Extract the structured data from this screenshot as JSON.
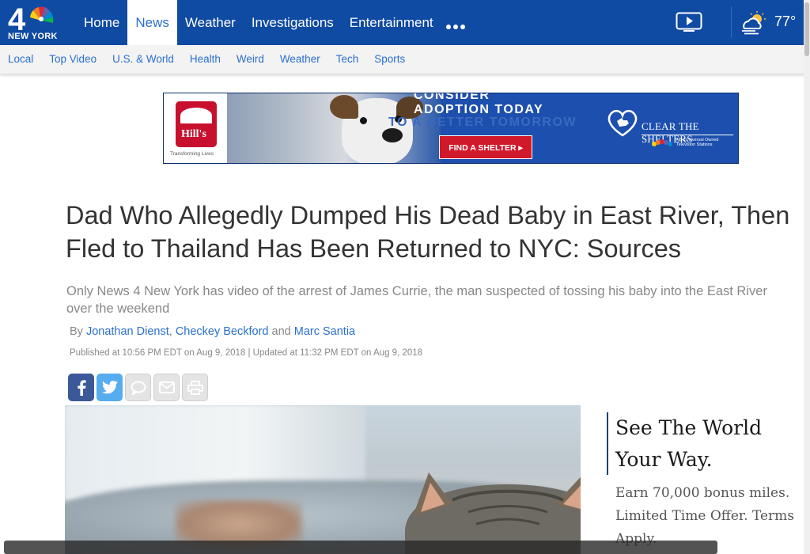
{
  "brand": {
    "logo_text": "NEW YORK"
  },
  "nav": {
    "items": [
      {
        "label": "Home",
        "active": false
      },
      {
        "label": "News",
        "active": true
      },
      {
        "label": "Weather",
        "active": false
      },
      {
        "label": "Investigations",
        "active": false
      },
      {
        "label": "Entertainment",
        "active": false
      }
    ],
    "more_icon": "more-dots-icon",
    "video_icon": "video-play-icon"
  },
  "weather": {
    "icon": "partly-cloudy-icon",
    "temp": "77°"
  },
  "subnav": {
    "items": [
      "Local",
      "Top Video",
      "U.S. & World",
      "Health",
      "Weird",
      "Weather",
      "Tech",
      "Sports"
    ]
  },
  "ad": {
    "hills_brand": "Hill's",
    "hills_tagline": "Transforming Lives",
    "headline_top": "CONSIDER",
    "headline": "ADOPTION TODAY",
    "ghost_text": "TO A BETTER TOMORROW",
    "cta": "FIND A SHELTER ▸",
    "partner": "CLEAR THE SHELTERS",
    "partner_sub": "NBCUniversal Owned Television Stations"
  },
  "article": {
    "headline": "Dad Who Allegedly Dumped His Dead Baby in East River, Then Fled to Thailand Has Been Returned to NYC: Sources",
    "headline_line1": "Dad Who Allegedly Dumped His Dead Baby in East River, Then",
    "headline_line2": "Fled to Thailand Has Been Returned to NYC: Sources",
    "dek_line1": "Only News 4 New York has video of the arrest of James Currie, the man suspected of tossing his baby into the East River",
    "dek_line2": "over the weekend",
    "byline_prefix": "By ",
    "authors": [
      "Jonathan Dienst",
      "Checkey Beckford",
      "Marc Santia"
    ],
    "sep1": ", ",
    "sep2": " and ",
    "published": "Published at 10:56 PM EDT on Aug 9, 2018 | Updated at 11:32 PM EDT on Aug 9, 2018"
  },
  "share": {
    "buttons": [
      "facebook-icon",
      "twitter-icon",
      "comment-icon",
      "email-icon",
      "print-icon"
    ]
  },
  "sponsor": {
    "title_line1": "See The World",
    "title_line2": "Your Way.",
    "body_line1": "Earn 70,000 bonus miles.",
    "body_line2": "Limited Time Offer. Terms",
    "body_line3": "Apply."
  },
  "colors": {
    "brand_blue": "#0f4aa3",
    "link_blue": "#2a6fce",
    "facebook": "#3b5998",
    "twitter": "#55acee",
    "ad_red": "#d0192b"
  }
}
